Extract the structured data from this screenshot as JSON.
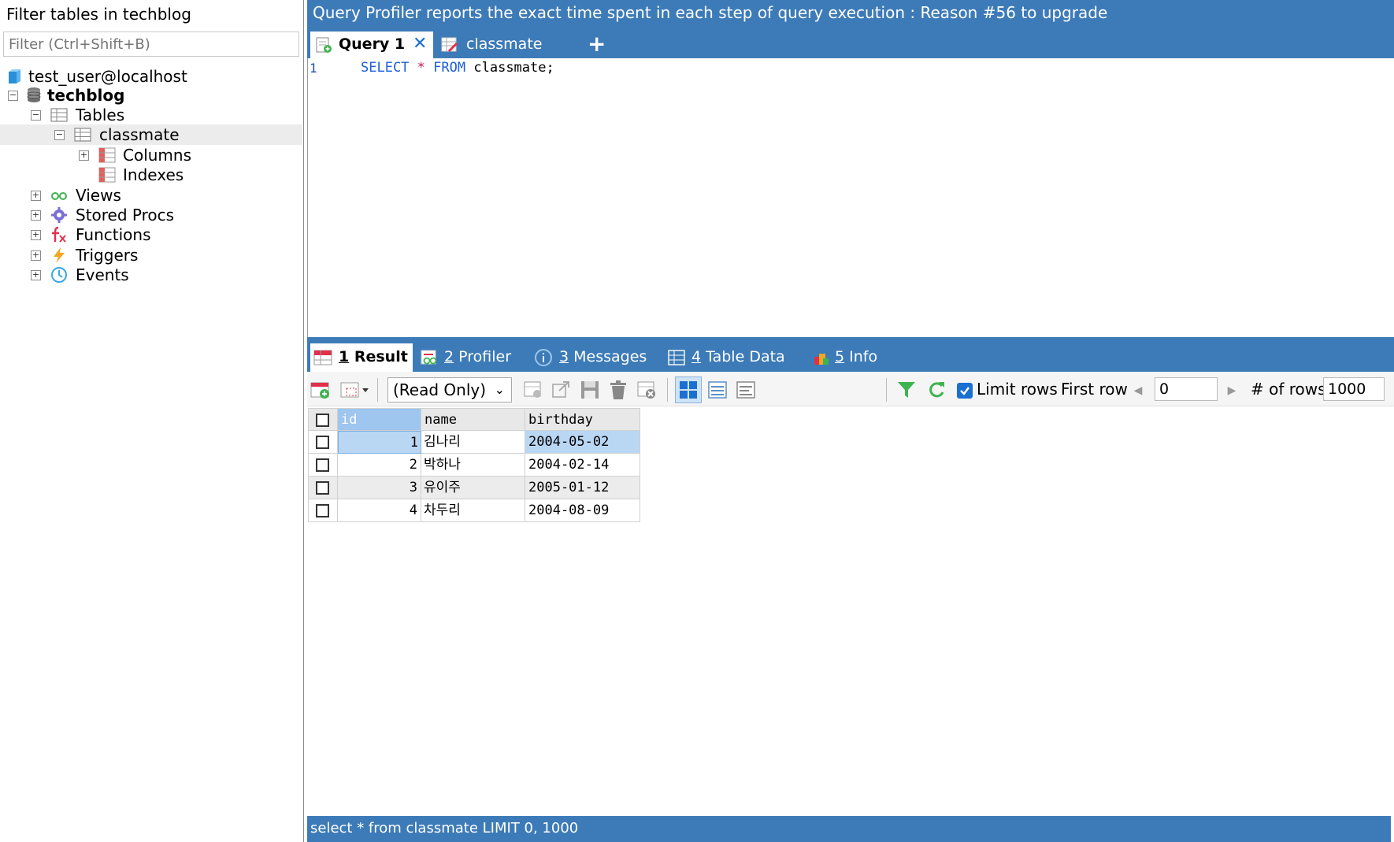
{
  "sidebar": {
    "filter_label": "Filter tables in techblog",
    "filter_placeholder": "Filter (Ctrl+Shift+B)",
    "connection": "test_user@localhost",
    "database": "techblog",
    "tables_label": "Tables",
    "table_name": "classmate",
    "columns_label": "Columns",
    "indexes_label": "Indexes",
    "views_label": "Views",
    "procs_label": "Stored Procs",
    "functions_label": "Functions",
    "triggers_label": "Triggers",
    "events_label": "Events"
  },
  "header": {
    "promo": "Query Profiler reports the exact time spent in each step of query execution : Reason #56 to upgrade",
    "tabs": [
      {
        "label": "Query 1"
      },
      {
        "label": "classmate"
      }
    ],
    "new_tab": "+"
  },
  "editor": {
    "line_number": "1",
    "kw_select": "SELECT",
    "star": "*",
    "kw_from": "FROM",
    "rest": "classmate;"
  },
  "results": {
    "tabs": [
      {
        "num": "1",
        "label": "Result"
      },
      {
        "num": "2",
        "label": "Profiler"
      },
      {
        "num": "3",
        "label": "Messages"
      },
      {
        "num": "4",
        "label": "Table Data"
      },
      {
        "num": "5",
        "label": "Info"
      }
    ],
    "read_only": "(Read Only)",
    "limit_rows": "Limit rows",
    "first_row_label": "First row",
    "first_row_value": "0",
    "num_rows_label": "# of rows",
    "num_rows_value": "1000"
  },
  "grid": {
    "columns": [
      "id",
      "name",
      "birthday"
    ],
    "rows": [
      [
        "1",
        "김나리",
        "2004-05-02"
      ],
      [
        "2",
        "박하나",
        "2004-02-14"
      ],
      [
        "3",
        "유이주",
        "2005-01-12"
      ],
      [
        "4",
        "차두리",
        "2004-08-09"
      ]
    ]
  },
  "status": {
    "query": "select * from classmate LIMIT 0, 1000"
  },
  "colors": {
    "accent": "#3d7bb8",
    "selected_cell": "#b9d6f3"
  }
}
